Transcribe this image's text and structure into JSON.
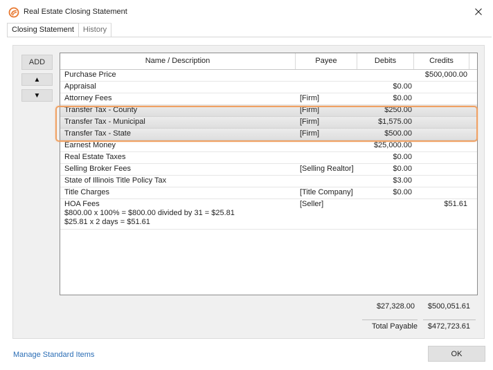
{
  "window": {
    "title": "Real Estate Closing Statement",
    "brand_color": "#e8772e"
  },
  "tabs": [
    {
      "label": "Closing Statement",
      "active": true
    },
    {
      "label": "History",
      "active": false
    }
  ],
  "side_buttons": {
    "add": "ADD",
    "up": "▲",
    "down": "▼"
  },
  "grid": {
    "columns": [
      "Name / Description",
      "Payee",
      "Debits",
      "Credits"
    ],
    "rows": [
      {
        "name": "Purchase Price",
        "payee": "",
        "debit": "",
        "credit": "$500,000.00"
      },
      {
        "name": "Appraisal",
        "payee": "",
        "debit": "$0.00",
        "credit": ""
      },
      {
        "name": "Attorney Fees",
        "payee": "[Firm]",
        "debit": "$0.00",
        "credit": ""
      },
      {
        "name": "Transfer Tax - County",
        "payee": "[Firm]",
        "debit": "$250.00",
        "credit": ""
      },
      {
        "name": "Transfer Tax - Municipal",
        "payee": "[Firm]",
        "debit": "$1,575.00",
        "credit": ""
      },
      {
        "name": "Transfer Tax - State",
        "payee": "[Firm]",
        "debit": "$500.00",
        "credit": ""
      },
      {
        "name": "Earnest Money",
        "payee": "",
        "debit": "$25,000.00",
        "credit": ""
      },
      {
        "name": "Real Estate Taxes",
        "payee": "",
        "debit": "$0.00",
        "credit": ""
      },
      {
        "name": "Selling Broker Fees",
        "payee": "[Selling Realtor]",
        "debit": "$0.00",
        "credit": ""
      },
      {
        "name": "State of Illinois Title Policy Tax",
        "payee": "",
        "debit": "$3.00",
        "credit": ""
      },
      {
        "name": "Title Charges",
        "payee": "[Title Company]",
        "debit": "$0.00",
        "credit": ""
      }
    ],
    "hoa": {
      "name": "HOA Fees",
      "line1": "$800.00 x 100% = $800.00 divided by 31 = $25.81",
      "line2": "$25.81 x 2 days = $51.61",
      "payee": "[Seller]",
      "debit": "",
      "credit": "$51.61"
    }
  },
  "totals": {
    "debits": "$27,328.00",
    "credits": "$500,051.61",
    "payable_label": "Total Payable",
    "payable_value": "$472,723.61"
  },
  "footer": {
    "manage_link": "Manage Standard Items",
    "ok": "OK"
  }
}
